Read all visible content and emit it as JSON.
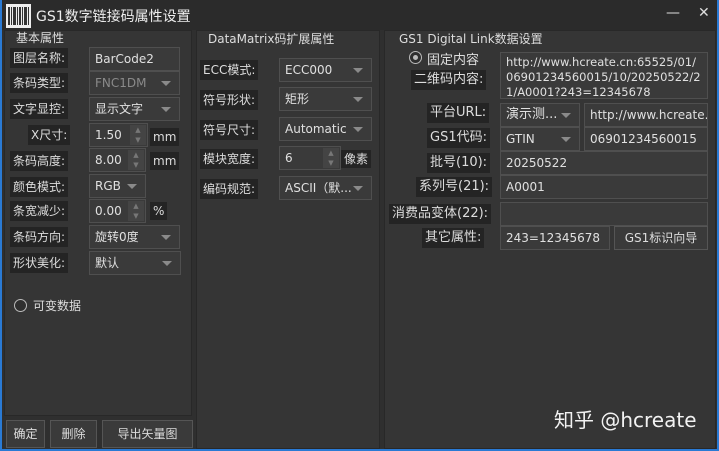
{
  "window": {
    "title": "GS1数字链接码属性设置",
    "minimize": "—",
    "close": "✕"
  },
  "basic": {
    "title": "基本属性",
    "layer_name": {
      "label": "图层名称:",
      "value": "BarCode2"
    },
    "barcode_type": {
      "label": "条码类型:",
      "value": "FNC1DM"
    },
    "text_display": {
      "label": "文字显控:",
      "value": "显示文字"
    },
    "x_size": {
      "label": "X尺寸:",
      "value": "1.50",
      "unit": "mm"
    },
    "bar_height": {
      "label": "条码高度:",
      "value": "8.00",
      "unit": "mm"
    },
    "color_mode": {
      "label": "颜色模式:",
      "value": "RGB"
    },
    "bar_reduce": {
      "label": "条宽减少:",
      "value": "0.00",
      "unit": "%"
    },
    "direction": {
      "label": "条码方向:",
      "value": "旋转0度"
    },
    "shape": {
      "label": "形状美化:",
      "value": "默认"
    },
    "variable_data": "可变数据"
  },
  "buttons": {
    "ok": "确定",
    "delete": "删除",
    "export": "导出矢量图"
  },
  "datamatrix": {
    "title": "DataMatrix码扩展属性",
    "ecc": {
      "label": "ECC模式:",
      "value": "ECC000"
    },
    "shape": {
      "label": "符号形状:",
      "value": "矩形"
    },
    "size": {
      "label": "符号尺寸:",
      "value": "Automatic"
    },
    "module": {
      "label": "模块宽度:",
      "value": "6",
      "unit": "像素"
    },
    "encoding": {
      "label": "编码规范:",
      "value": "ASCII（默..."
    }
  },
  "gs1": {
    "title": "GS1 Digital Link数据设置",
    "fixed": "固定内容",
    "content": {
      "label": "二维码内容:",
      "value": "http://www.hcreate.cn:65525/01/06901234560015/10/20250522/21/A0001?243=12345678"
    },
    "platform": {
      "label": "平台URL:",
      "select": "演示测...",
      "value": "http://www.hcreate.cn"
    },
    "code": {
      "label": "GS1代码:",
      "select": "GTIN",
      "value": "06901234560015"
    },
    "batch": {
      "label": "批号(10):",
      "value": "20250522"
    },
    "serial": {
      "label": "系列号(21):",
      "value": "A0001"
    },
    "variant": {
      "label": "消费品变体(22):",
      "value": ""
    },
    "other": {
      "label": "其它属性:",
      "value": "243=12345678"
    },
    "wizard": "GS1标识向导"
  },
  "watermark": "知乎 @hcreate"
}
